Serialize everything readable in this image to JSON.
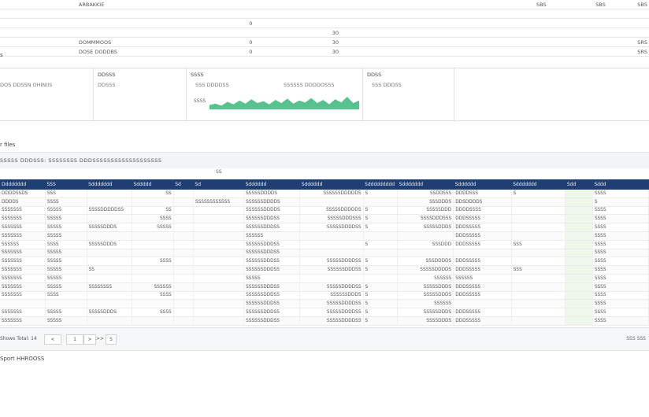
{
  "top_table": {
    "rows": [
      [
        "",
        "ARBAKKIE",
        "",
        "",
        "",
        "",
        "SBS",
        "SBS",
        "SBS"
      ],
      [
        "",
        "",
        "",
        "",
        "",
        "",
        "",
        "",
        ""
      ],
      [
        "",
        "",
        "0",
        "",
        "",
        "",
        "",
        "",
        ""
      ],
      [
        "",
        "",
        "",
        "30",
        "",
        "",
        "",
        "",
        ""
      ],
      [
        "",
        "DOMMMOOS",
        "0",
        "30",
        "",
        "",
        "",
        "",
        "SRS"
      ],
      [
        "",
        "DOSE DODDBS",
        "0",
        "30",
        "",
        "",
        "",
        "",
        "SRS"
      ]
    ]
  },
  "section_1_label": "s",
  "panels": [
    {
      "title": "",
      "value": "DOS DDSSN OHINIIS",
      "value2": ""
    },
    {
      "title": "DDSSS",
      "value": "DDSSS",
      "value2": ""
    },
    {
      "title": "SSSS",
      "value": "SSS DDDDSS",
      "value2": "SSSSSS DDDDOSSS",
      "chart_label": "SSSS"
    },
    {
      "title": "DDSS",
      "value": "SSS DDDSS",
      "value2": ""
    }
  ],
  "sparkline": [
    0.35,
    0.45,
    0.3,
    0.6,
    0.4,
    0.7,
    0.45,
    0.8,
    0.5,
    0.65,
    0.4,
    0.75,
    0.5,
    0.85,
    0.45,
    0.7,
    0.55,
    0.9,
    0.5,
    0.75,
    0.4,
    0.8,
    0.55,
    1.0,
    0.5,
    0.7
  ],
  "section_2_label": "r files",
  "filter_text": "SSSSS DDDSSS: SSSSSSSS DDDSSSSSSSSSSSSSSSSSSS",
  "filter_sub": "SS",
  "grid": {
    "headers": [
      "Dddddddd",
      "SSS",
      "Sddddddd",
      "Sddddd",
      "Sd",
      "Sd",
      "Sdddddd",
      "Sdddddd",
      "Sddddddddd",
      "Sddddddd",
      "Sdddddd",
      "Sddddddd",
      "Sdd",
      "Sddd"
    ],
    "rows": [
      [
        "DDDDSSDS",
        "SSS",
        "",
        "SS",
        "",
        "",
        "SSSSSDDDDS",
        "SSSSSSDDDDDS",
        "S",
        "SSDDSSS",
        "DDDDSSS",
        "S",
        "",
        "SSSS"
      ],
      [
        "DDDDS",
        "SSSS",
        "",
        "",
        "",
        "SSSSSSSSSSSS",
        "SSSSSSDDDDS",
        "",
        "",
        "SSSDDDS",
        "DDSDDDDS",
        "",
        "",
        "S"
      ],
      [
        "SSSSSSS",
        "SSSSS",
        "SSSSDDDDDSS",
        "SS",
        "",
        "",
        "SSSSSSDDDDS",
        "SSSSSDDDDDS",
        "S",
        "SSSSSDDD",
        "DDDDSSSS",
        "",
        "",
        "SSSS"
      ],
      [
        "SSSSSSS",
        "SSSSS",
        "",
        "SSSS",
        "",
        "",
        "SSSSSSDDDSS",
        "SSSSSDDDSSS",
        "S",
        "SSSSDDDSSS",
        "DDDSSSSS",
        "",
        "",
        "SSSS"
      ],
      [
        "SSSSSSS",
        "SSSSS",
        "SSSSSDDDS",
        "SSSSS",
        "",
        "",
        "SSSSSSDDDSS",
        "SSSSSDDDDSS",
        "S",
        "SSSSSDDDS",
        "DDDSSSSS",
        "",
        "",
        "SSSS"
      ],
      [
        "SSSSSSS",
        "SSSSS",
        "",
        "",
        "",
        "",
        "SSSSSS",
        "",
        "",
        "",
        "DDDSSSSS",
        "",
        "",
        "SSSS"
      ],
      [
        "SSSSSS",
        "SSSS",
        "SSSSSDDDS",
        "",
        "",
        "",
        "SSSSSSDDDSS",
        "",
        "S",
        "SSSDDD",
        "DDDSSSSS",
        "SSS",
        "",
        "SSSS"
      ],
      [
        "SSSSSSS",
        "SSSSS",
        "",
        "",
        "",
        "",
        "SSSSSSDDDSS",
        "",
        "",
        "",
        "",
        "",
        "",
        "SSSS"
      ],
      [
        "SSSSSSS",
        "SSSSS",
        "",
        "SSSS",
        "",
        "",
        "SSSSSSDDDSS",
        "SSSSSDDDDSS",
        "S",
        "SSSDDDDS",
        "DDDSSSSS",
        "",
        "",
        "SSSS"
      ],
      [
        "SSSSSSS",
        "SSSSS",
        "SS",
        "",
        "",
        "",
        "SSSSSSDDDSS",
        "SSSSSSDDDSS",
        "S",
        "SSSSSDDDDS",
        "DDDSSSSS",
        "SSS",
        "",
        "SSSS"
      ],
      [
        "SSSSSSS",
        "SSSSS",
        "",
        "",
        "",
        "",
        "SSSSS",
        "",
        "",
        "SSSSSS",
        "SSSSSS",
        "",
        "",
        "SSSS"
      ],
      [
        "SSSSSSS",
        "SSSSS",
        "SSSSSSSS",
        "SSSSSS",
        "",
        "",
        "SSSSSSDDDSS",
        "SSSSSDDDDSS",
        "S",
        "SSSSSDDDS",
        "DDDSSSSS",
        "",
        "",
        "SSSS"
      ],
      [
        "SSSSSSS",
        "SSSS",
        "",
        "SSSS",
        "",
        "",
        "SSSSSSDDDSS",
        "SSSSSSDDDS",
        "S",
        "SSSSSDDDS",
        "DDDSSSSS",
        "",
        "",
        "SSSS"
      ],
      [
        "",
        "",
        "",
        "",
        "",
        "",
        "SSSSSSDDDSS",
        "SSSSSDDDDSS",
        "S",
        "SSSSSS",
        "",
        "",
        "",
        "SSSS"
      ],
      [
        "SSSSSSS",
        "SSSSS",
        "SSSSSDDDS",
        "SSSS",
        "",
        "",
        "SSSSSSDDDSS",
        "SSSSSDDDDSS",
        "S",
        "SSSSSDDDS",
        "DDDSSSSS",
        "",
        "",
        "SSSS"
      ],
      [
        "SSSSSSS",
        "SSSSS",
        "",
        "",
        "",
        "",
        "SSSSSSDDDSS",
        "SSSSSDDDDSS",
        "S",
        "SSSSDDDS",
        "DDDSSSSS",
        "",
        "",
        "SSSS"
      ]
    ]
  },
  "pager": {
    "label": "Shows Total: 14",
    "buttons": [
      "<",
      "1",
      ">",
      ">>",
      "S"
    ],
    "right_text": "SSS SSS"
  },
  "footer_text": "Sport HHROOSS",
  "colors": {
    "header_bg": "#1f3e72",
    "sparkline": "#38b87a"
  }
}
